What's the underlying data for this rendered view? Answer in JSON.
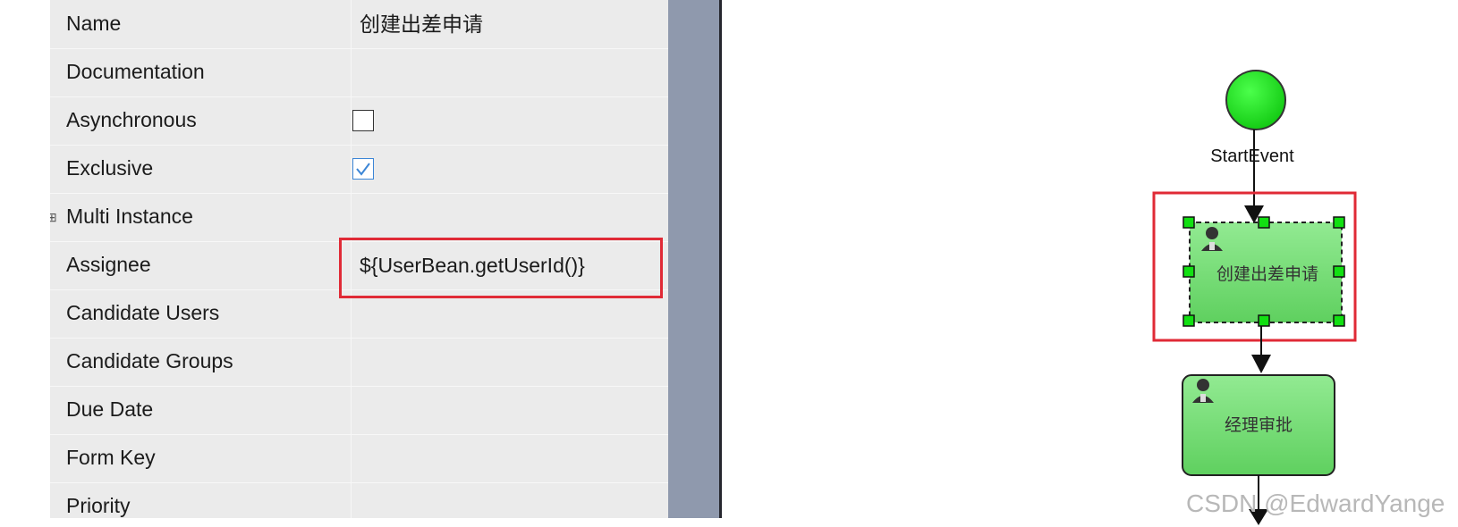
{
  "properties": {
    "rows": [
      {
        "name": "Name",
        "value": "创建出差申请"
      },
      {
        "name": "Documentation",
        "value": ""
      },
      {
        "name": "Asynchronous",
        "value": "unchecked"
      },
      {
        "name": "Exclusive",
        "value": "checked"
      },
      {
        "name": "Multi Instance",
        "value": ""
      },
      {
        "name": "Assignee",
        "value": "${UserBean.getUserId()}"
      },
      {
        "name": "Candidate Users",
        "value": ""
      },
      {
        "name": "Candidate Groups",
        "value": ""
      },
      {
        "name": "Due Date",
        "value": ""
      },
      {
        "name": "Form Key",
        "value": ""
      },
      {
        "name": "Priority",
        "value": ""
      }
    ],
    "multi_instance_expander": "⊞",
    "highlight_color": "#e02a36"
  },
  "diagram": {
    "start_event_label": "StartEvent",
    "task1_label": "创建出差申请",
    "task2_label": "经理审批",
    "start_event_color": "#1fdf1f",
    "task_fill": "#6dd66d",
    "selection_handle_color": "#12e012"
  },
  "watermark": "CSDN @EdwardYange"
}
